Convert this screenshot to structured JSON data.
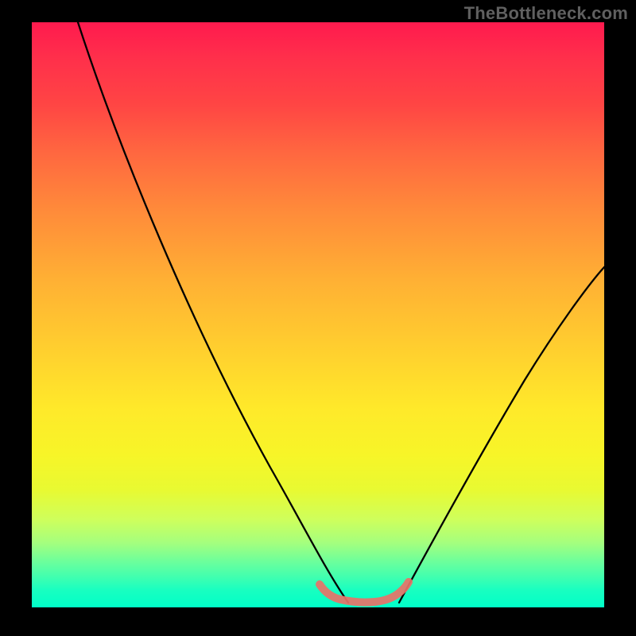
{
  "watermark": "TheBottleneck.com",
  "colors": {
    "background": "#000000",
    "gradient_top": "#ff1a4e",
    "gradient_bottom": "#00ffc8",
    "marker": "#e97268",
    "curve": "#000000"
  },
  "chart_data": {
    "type": "line",
    "title": "",
    "xlabel": "",
    "ylabel": "",
    "xlim": [
      0,
      100
    ],
    "ylim": [
      0,
      100
    ],
    "series": [
      {
        "name": "left-curve",
        "x": [
          8,
          12,
          16,
          20,
          24,
          28,
          32,
          36,
          40,
          44,
          48,
          50,
          52,
          54,
          55.5
        ],
        "y": [
          100,
          92,
          84,
          76,
          68,
          59,
          50,
          41,
          32,
          23,
          14,
          9,
          5,
          2,
          0.5
        ]
      },
      {
        "name": "right-curve",
        "x": [
          64,
          66,
          70,
          74,
          78,
          82,
          86,
          90,
          94,
          98,
          100
        ],
        "y": [
          0.5,
          3,
          9,
          16,
          23,
          30,
          37,
          43,
          49,
          55,
          58
        ]
      },
      {
        "name": "bottom-marker",
        "x": [
          50,
          52,
          54,
          56,
          58,
          60,
          62,
          64,
          65.5
        ],
        "y": [
          4,
          2.2,
          1.4,
          1.0,
          1.0,
          1.2,
          1.6,
          2.4,
          4.2
        ]
      }
    ]
  }
}
